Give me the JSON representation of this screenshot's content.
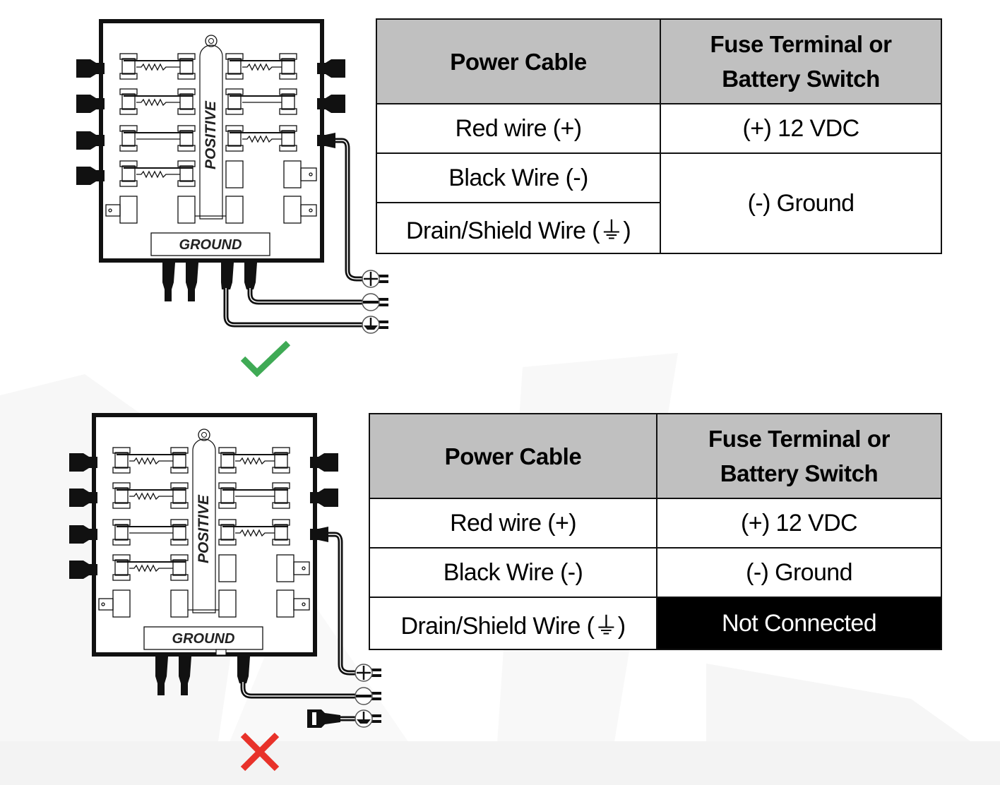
{
  "figure": {
    "colors": {
      "correct": "#3faa55",
      "incorrect": "#e8322a",
      "header_fill": "#c0c0c0",
      "highlight_fill": "#000000"
    },
    "diagrams": [
      {
        "id": "correct",
        "status_icon": "check-mark-icon",
        "fuse_block": {
          "positive_label": "POSITIVE",
          "ground_label": "GROUND",
          "terminals": [
            "+",
            "−",
            "⏚"
          ],
          "drain_connected": true
        },
        "table": {
          "headers": [
            "Power Cable",
            "Fuse Terminal or Battery Switch"
          ],
          "header_lines": [
            [
              "Power Cable"
            ],
            [
              "Fuse Terminal or",
              "Battery Switch"
            ]
          ],
          "rows": [
            {
              "cable": "Red wire (+)",
              "terminal": "(+) 12 VDC"
            },
            {
              "cable": "Black Wire (-)",
              "terminal": "(-) Ground"
            },
            {
              "cable": "Drain/Shield Wire (⏚)",
              "terminal": "(-) Ground"
            }
          ],
          "merged_terminal": "(-) Ground"
        }
      },
      {
        "id": "incorrect",
        "status_icon": "x-mark-icon",
        "fuse_block": {
          "positive_label": "POSITIVE",
          "ground_label": "GROUND",
          "terminals": [
            "+",
            "−",
            "⏚"
          ],
          "drain_connected": false
        },
        "table": {
          "headers": [
            "Power Cable",
            "Fuse Terminal or Battery Switch"
          ],
          "header_lines": [
            [
              "Power Cable"
            ],
            [
              "Fuse Terminal or",
              "Battery Switch"
            ]
          ],
          "rows": [
            {
              "cable": "Red wire (+)",
              "terminal": "(+) 12 VDC"
            },
            {
              "cable": "Black Wire (-)",
              "terminal": "(-) Ground"
            },
            {
              "cable": "Drain/Shield Wire (⏚)",
              "terminal": "Not Connected"
            }
          ]
        }
      }
    ]
  }
}
